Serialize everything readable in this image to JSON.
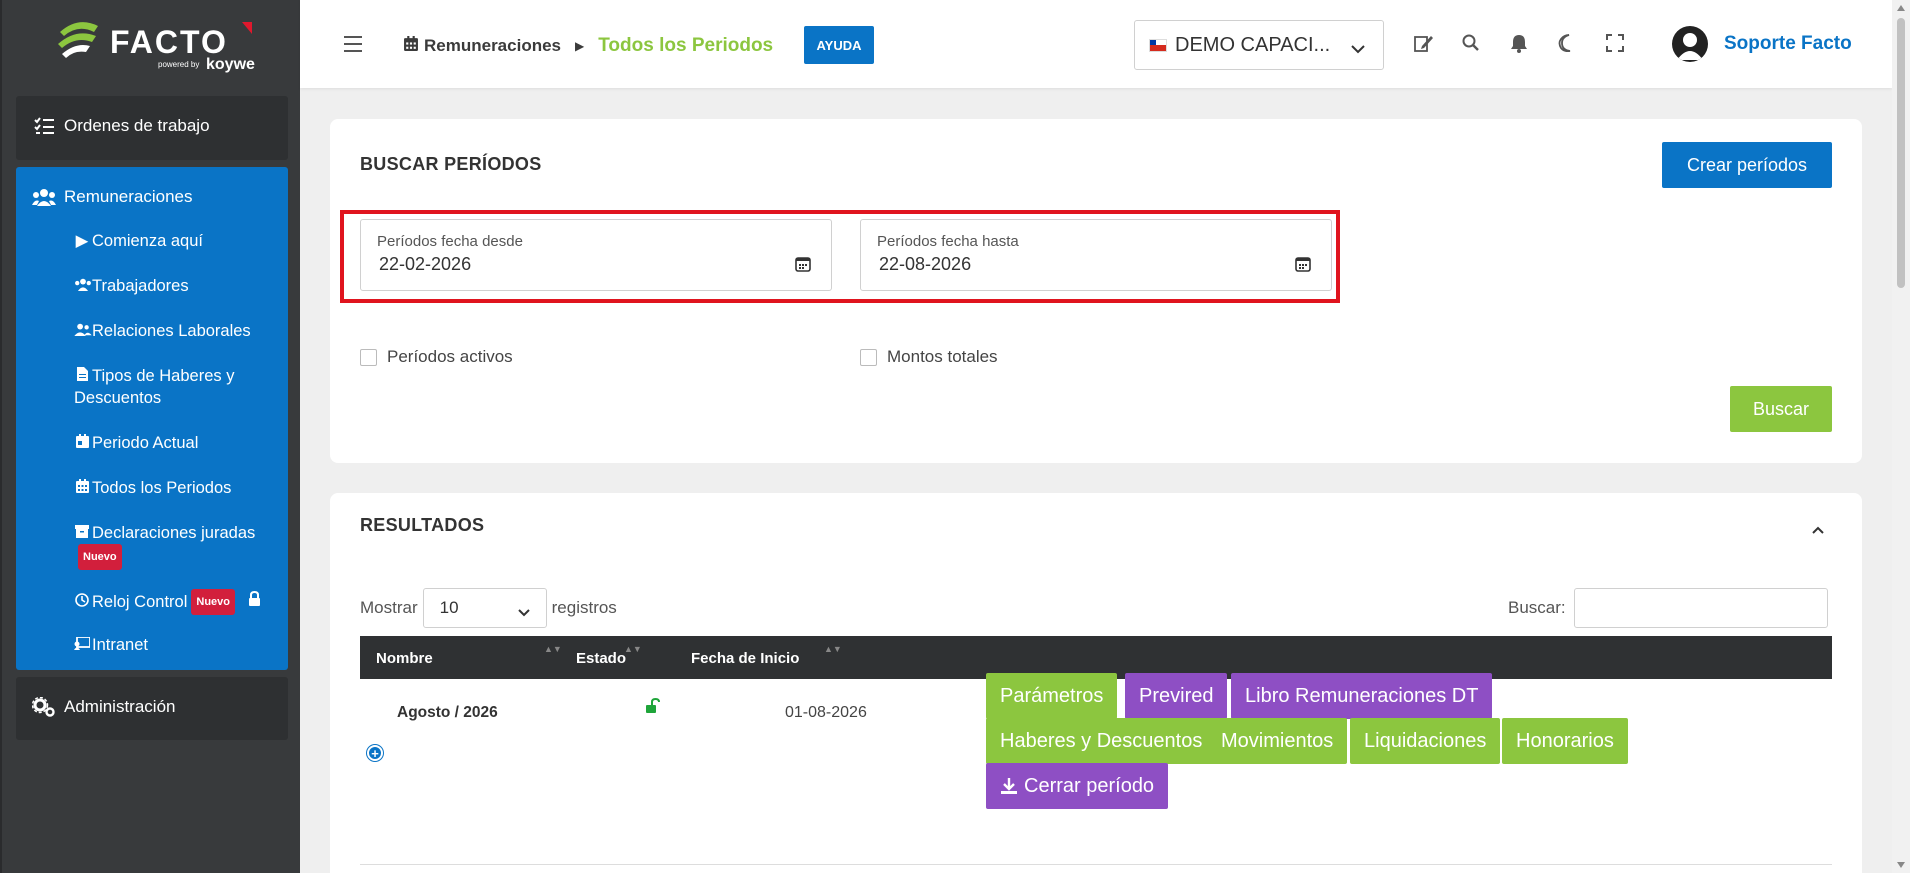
{
  "brand": {
    "name": "FACTO",
    "powered": "powered by",
    "partner": "koywe"
  },
  "sidebar": {
    "top_item": "Ordenes de trabajo",
    "section": "Remuneraciones",
    "items": [
      {
        "label": "Comienza aquí"
      },
      {
        "label": "Trabajadores"
      },
      {
        "label": "Relaciones Laborales"
      },
      {
        "label": "Tipos de Haberes y Descuentos"
      },
      {
        "label": "Periodo Actual"
      },
      {
        "label": "Todos los Periodos"
      },
      {
        "label": "Declaraciones juradas",
        "badge": "Nuevo"
      },
      {
        "label": "Reloj Control",
        "badge": "Nuevo"
      },
      {
        "label": "Intranet"
      }
    ],
    "admin": "Administración"
  },
  "topbar": {
    "breadcrumb_parent": "Remuneraciones",
    "breadcrumb_current": "Todos los Periodos",
    "help": "AYUDA",
    "company": "DEMO CAPACI...",
    "user": "Soporte Facto"
  },
  "search_card": {
    "title": "BUSCAR PERÍODOS",
    "create_button": "Crear períodos",
    "from_label": "Períodos fecha desde",
    "from_value": "22-02-2026",
    "to_label": "Períodos fecha hasta",
    "to_value": "22-08-2026",
    "active_label": "Períodos activos",
    "totals_label": "Montos totales",
    "search_button": "Buscar"
  },
  "results": {
    "title": "RESULTADOS",
    "show_label": "Mostrar",
    "show_value": "10",
    "records_label": "registros",
    "search_label": "Buscar:",
    "columns": [
      "Nombre",
      "Estado",
      "Fecha de Inicio"
    ],
    "row": {
      "name": "Agosto / 2026",
      "start_date": "01-08-2026",
      "actions": [
        "Parámetros",
        "Previred",
        "Libro Remuneraciones DT",
        "Haberes y Descuentos",
        "Movimientos",
        "Liquidaciones",
        "Honorarios",
        "Cerrar período"
      ]
    }
  },
  "colors": {
    "primary_blue": "#0a74c6",
    "green": "#8cc63f",
    "purple": "#8e4fc4",
    "badge_red": "#d21f3c",
    "highlight_red": "#e0141e"
  }
}
